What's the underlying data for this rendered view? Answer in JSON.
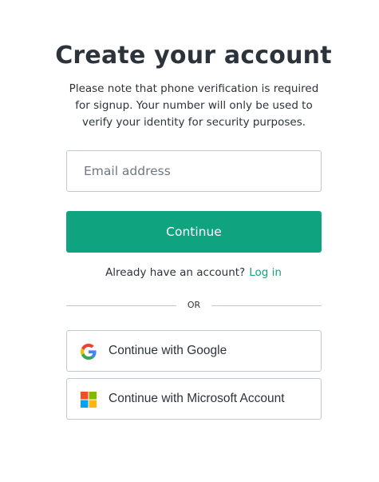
{
  "header": {
    "title": "Create your account",
    "subtitle": "Please note that phone verification is required for signup. Your number will only be used to verify your identity for security purposes."
  },
  "form": {
    "email_placeholder": "Email address",
    "email_value": "",
    "continue_label": "Continue"
  },
  "login": {
    "prompt": "Already have an account?",
    "link_label": "Log in"
  },
  "divider": {
    "label": "OR"
  },
  "social": {
    "google_label": "Continue with Google",
    "microsoft_label": "Continue with Microsoft Account"
  },
  "colors": {
    "accent": "#10a37f",
    "text": "#2d333a",
    "border": "#c2c8d0"
  }
}
